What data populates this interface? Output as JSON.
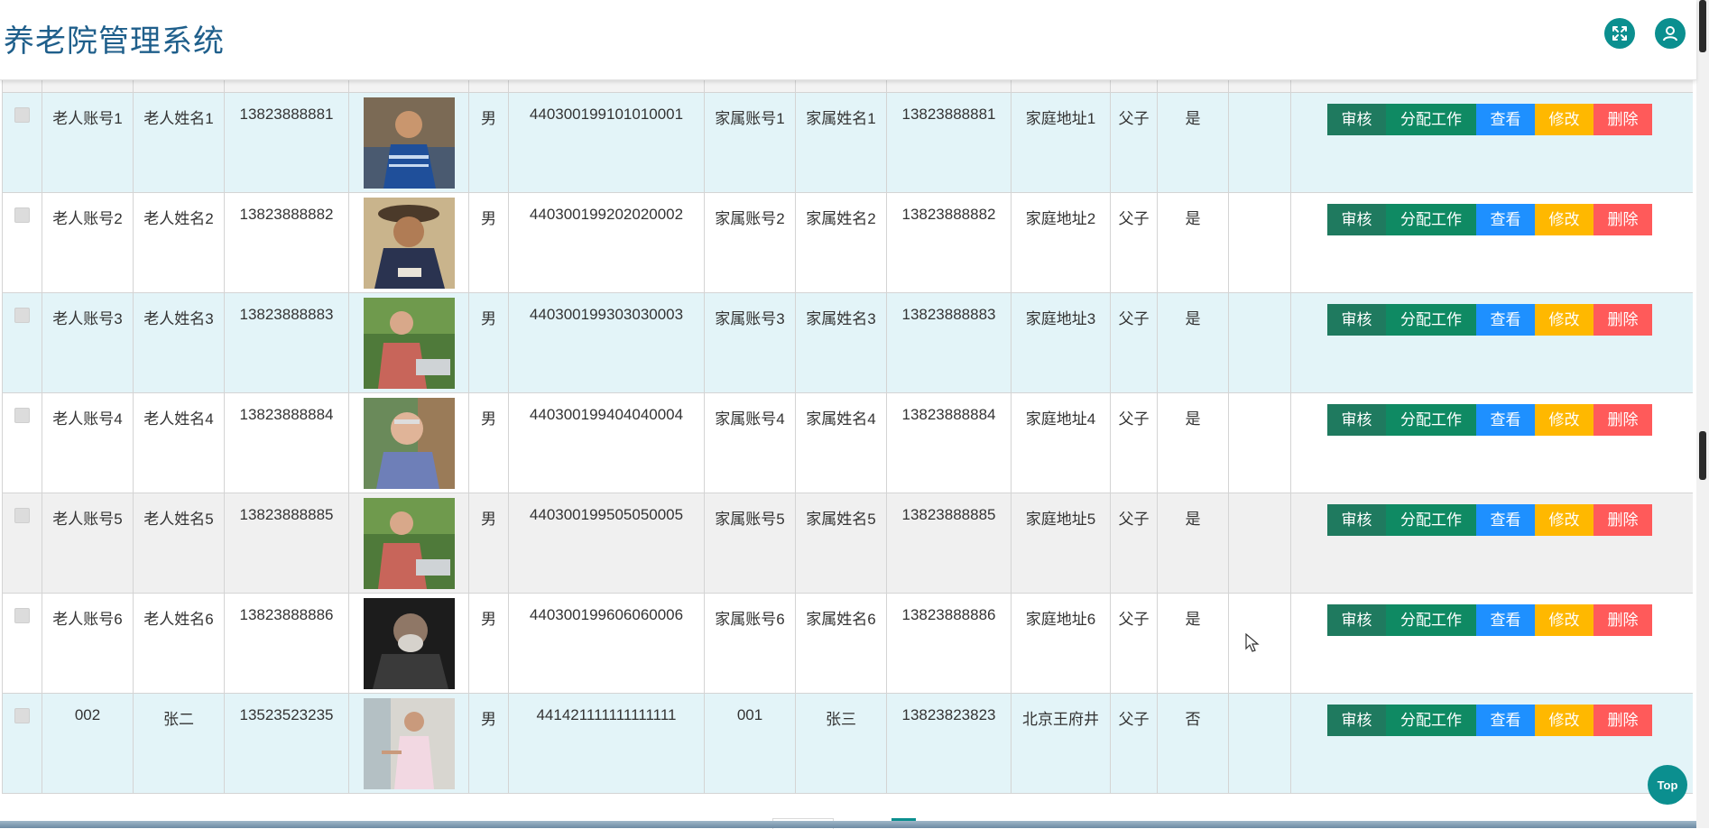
{
  "app": {
    "title": "养老院管理系统"
  },
  "header": {
    "fullscreen_icon": "fullscreen-icon",
    "user_icon": "user-icon"
  },
  "actions": {
    "audit": "审核",
    "assign": "分配工作",
    "view": "查看",
    "edit": "修改",
    "delete": "删除"
  },
  "colors": {
    "brand": "#0b8f8f",
    "title": "#1f5f8b",
    "audit": "#1f7a5f",
    "assign": "#0f8a63",
    "view": "#1e90ff",
    "edit": "#ffb800",
    "delete": "#ff5a5a",
    "row_alt": "#e3f4f8"
  },
  "rows": [
    {
      "account": "老人账号1",
      "name": "老人姓名1",
      "phone": "13823888881",
      "gender": "男",
      "id_number": "440300199101010001",
      "family_account": "家属账号1",
      "family_name": "家属姓名1",
      "family_phone": "13823888881",
      "address": "家庭地址1",
      "relation": "父子",
      "status": "是",
      "extra": ""
    },
    {
      "account": "老人账号2",
      "name": "老人姓名2",
      "phone": "13823888882",
      "gender": "男",
      "id_number": "440300199202020002",
      "family_account": "家属账号2",
      "family_name": "家属姓名2",
      "family_phone": "13823888882",
      "address": "家庭地址2",
      "relation": "父子",
      "status": "是",
      "extra": ""
    },
    {
      "account": "老人账号3",
      "name": "老人姓名3",
      "phone": "13823888883",
      "gender": "男",
      "id_number": "440300199303030003",
      "family_account": "家属账号3",
      "family_name": "家属姓名3",
      "family_phone": "13823888883",
      "address": "家庭地址3",
      "relation": "父子",
      "status": "是",
      "extra": ""
    },
    {
      "account": "老人账号4",
      "name": "老人姓名4",
      "phone": "13823888884",
      "gender": "男",
      "id_number": "440300199404040004",
      "family_account": "家属账号4",
      "family_name": "家属姓名4",
      "family_phone": "13823888884",
      "address": "家庭地址4",
      "relation": "父子",
      "status": "是",
      "extra": ""
    },
    {
      "account": "老人账号5",
      "name": "老人姓名5",
      "phone": "13823888885",
      "gender": "男",
      "id_number": "440300199505050005",
      "family_account": "家属账号5",
      "family_name": "家属姓名5",
      "family_phone": "13823888885",
      "address": "家庭地址5",
      "relation": "父子",
      "status": "是",
      "extra": ""
    },
    {
      "account": "老人账号6",
      "name": "老人姓名6",
      "phone": "13823888886",
      "gender": "男",
      "id_number": "440300199606060006",
      "family_account": "家属账号6",
      "family_name": "家属姓名6",
      "family_phone": "13823888886",
      "address": "家庭地址6",
      "relation": "父子",
      "status": "是",
      "extra": ""
    },
    {
      "account": "002",
      "name": "张二",
      "phone": "13523523235",
      "gender": "男",
      "id_number": "441421111111111111",
      "family_account": "001",
      "family_name": "张三",
      "family_phone": "13823823823",
      "address": "北京王府井",
      "relation": "父子",
      "status": "否",
      "extra": ""
    }
  ],
  "scroll_top": {
    "label": "Top"
  }
}
